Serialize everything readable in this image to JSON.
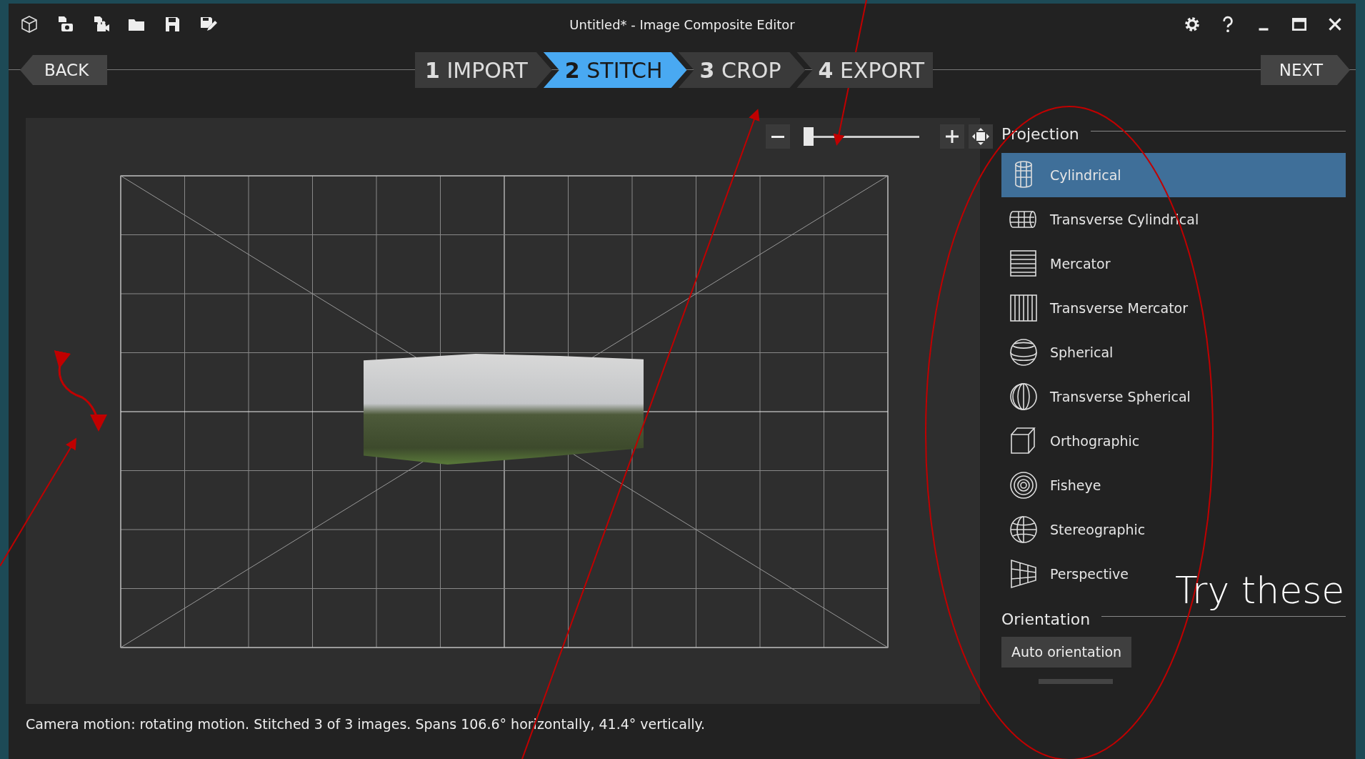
{
  "window": {
    "title": "Untitled* - Image Composite Editor"
  },
  "wizard": {
    "back": "BACK",
    "next": "NEXT",
    "steps": [
      {
        "number": "1",
        "label": "IMPORT",
        "selected": false
      },
      {
        "number": "2",
        "label": "STITCH",
        "selected": true
      },
      {
        "number": "3",
        "label": "CROP",
        "selected": false
      },
      {
        "number": "4",
        "label": "EXPORT",
        "selected": false
      }
    ]
  },
  "zoom": {
    "level": 0.03
  },
  "projection": {
    "heading": "Projection",
    "items": [
      {
        "label": "Cylindrical",
        "selected": true
      },
      {
        "label": "Transverse Cylindrical",
        "selected": false
      },
      {
        "label": "Mercator",
        "selected": false
      },
      {
        "label": "Transverse Mercator",
        "selected": false
      },
      {
        "label": "Spherical",
        "selected": false
      },
      {
        "label": "Transverse Spherical",
        "selected": false
      },
      {
        "label": "Orthographic",
        "selected": false
      },
      {
        "label": "Fisheye",
        "selected": false
      },
      {
        "label": "Stereographic",
        "selected": false
      },
      {
        "label": "Perspective",
        "selected": false
      }
    ]
  },
  "orientation": {
    "heading": "Orientation",
    "button": "Auto orientation"
  },
  "status_bar": "Camera motion: rotating motion. Stitched 3 of 3 images. Spans 106.6° horizontally, 41.4° vertically.",
  "annotation": {
    "text": "Try these"
  }
}
